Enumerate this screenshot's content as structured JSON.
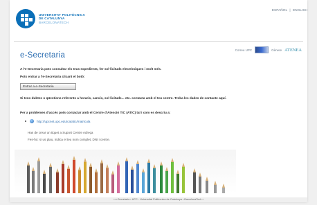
{
  "header": {
    "logo_line1": "UNIVERSITAT POLITÈCNICA",
    "logo_line2": "DE CATALUNYA",
    "logo_line3": "BARCELONATECH",
    "lang_es": "ESPAÑOL",
    "lang_sep": "|",
    "lang_en": "ENGLISH"
  },
  "toplinks": {
    "correu": "Correu UPC",
    "genero": "Gènere",
    "atenea": "ATENEA"
  },
  "main": {
    "title": "e-Secretaria",
    "intro": "A l'e-Secretaria pots consultar els teus expedients, fer sol·licituds electròniques i molt més.",
    "access_prompt": "Pots entrar a l'e-Secretaria clicant el botó:",
    "access_button": "Entrar a e-Secretaria",
    "doubts": "Si tens dubtes o qüestions referents a horaris, canvis, sol·licituds... etc. contacta amb el teu centre. Troba les dades de contacte aquí.",
    "problems": "Per a problemes d'accés pots contactar amb el Centre d'Atenció TIC (ATIC) tal i com es descriu a:",
    "link": "http://upcnet.upc.edu/ca/atic/matricula",
    "note1": "Has de crear un tiquet a Suport Centre Adreça",
    "note2": "Fes-ho: si us plau, indica el teu nom complet, DNI i centre."
  },
  "footer": {
    "text": "• e-Secretaria • UPC - Universitat Politècnica de Catalunya • BarcelonaTech •"
  },
  "colors": {
    "brand_blue": "#0a6fb8",
    "title_blue": "#2b6db1"
  }
}
